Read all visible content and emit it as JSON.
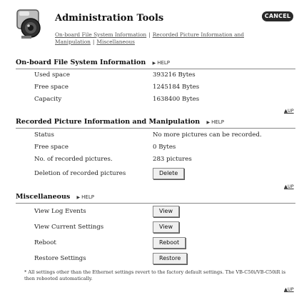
{
  "header": {
    "title": "Administration Tools",
    "cancel_label": "CANCEL",
    "links": [
      "On-board File System Information",
      "Recorded Picture Information and Manipulation",
      "Miscellaneous"
    ],
    "separator": "|"
  },
  "help_label": "HELP",
  "up_label": "UP",
  "fs": {
    "title": "On-board File System Information",
    "rows": [
      {
        "label": "Used space",
        "value": "393216 Bytes"
      },
      {
        "label": "Free space",
        "value": "1245184 Bytes"
      },
      {
        "label": "Capacity",
        "value": "1638400 Bytes"
      }
    ]
  },
  "pics": {
    "title": "Recorded Picture Information and Manipulation",
    "rows": [
      {
        "label": "Status",
        "value": "No more pictures can be recorded."
      },
      {
        "label": "Free space",
        "value": "0 Bytes"
      },
      {
        "label": "No. of recorded pictures.",
        "value": "283 pictures"
      }
    ],
    "delete_label": "Deletion of recorded pictures",
    "delete_button": "Delete"
  },
  "misc": {
    "title": "Miscellaneous",
    "rows": [
      {
        "label": "View Log Events",
        "button": "View"
      },
      {
        "label": "View Current Settings",
        "button": "View"
      },
      {
        "label": "Reboot",
        "button": "Reboot"
      },
      {
        "label": "Restore Settings",
        "button": "Restore"
      }
    ],
    "note": "* All settings other than the Ethernet settings revert to the factory default settings. The VB-C50i/VB-C50iR is then rebooted automatically."
  }
}
